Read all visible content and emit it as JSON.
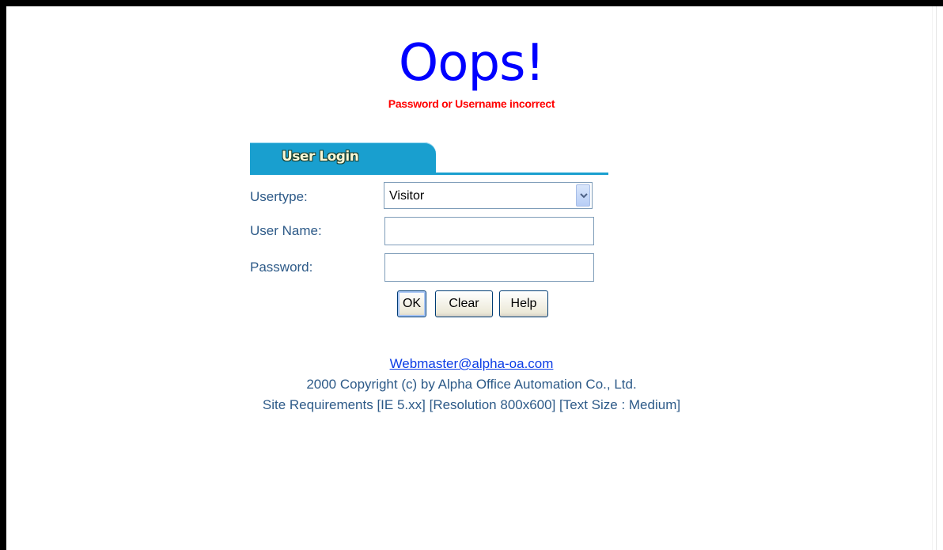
{
  "heading": "Oops!",
  "error_message": "Password or Username incorrect",
  "login": {
    "tab_title": "User Login",
    "usertype_label": "Usertype:",
    "usertype_value": "Visitor",
    "username_label": "User Name:",
    "username_value": "",
    "password_label": "Password:",
    "password_value": "",
    "buttons": {
      "ok": "OK",
      "clear": "Clear",
      "help": "Help"
    }
  },
  "footer": {
    "email": "Webmaster@alpha-oa.com",
    "copyright": "2000 Copyright (c) by Alpha Office Automation Co., Ltd.",
    "requirements": "Site Requirements [IE 5.xx] [Resolution 800x600] [Text Size : Medium]"
  },
  "icons": {
    "dropdown": "chevron-down-icon"
  },
  "colors": {
    "heading": "#0000ff",
    "error": "#ff0000",
    "tab_accent": "#199fcf",
    "label_text": "#2d5a88",
    "link": "#0b3de6"
  }
}
